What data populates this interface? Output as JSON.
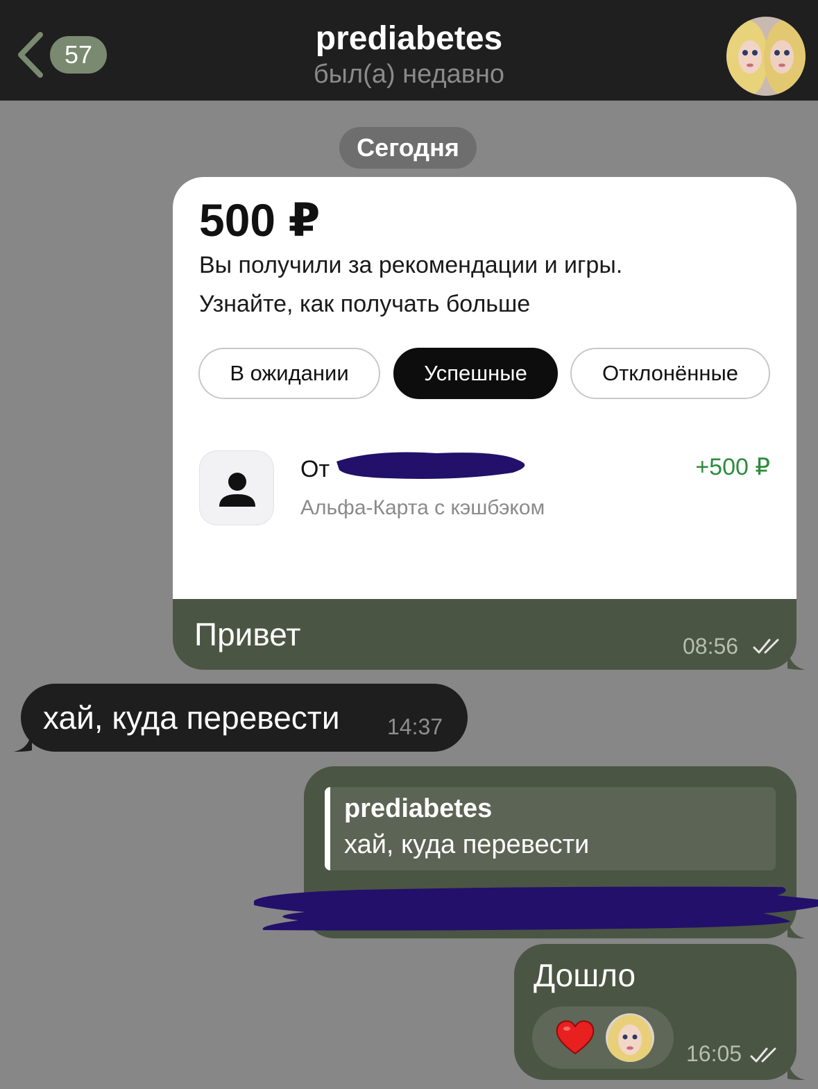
{
  "header": {
    "back_count": "57",
    "title": "prediabetes",
    "status": "был(а) недавно"
  },
  "date_separator": "Сегодня",
  "payment_card": {
    "amount": "500 ₽",
    "line1": "Вы получили за рекомендации и игры.",
    "line2": "Узнайте, как получать больше",
    "chips": [
      {
        "label": "В ожидании",
        "active": false
      },
      {
        "label": "Успешные",
        "active": true
      },
      {
        "label": "Отклонённые",
        "active": false
      }
    ],
    "transaction": {
      "from_prefix": "От",
      "subtitle": "Альфа-Карта с кэшбэком",
      "amount": "+500 ₽"
    }
  },
  "messages": [
    {
      "direction": "out",
      "text": "Привет",
      "time": "08:56"
    },
    {
      "direction": "in",
      "text": "хай, куда перевести",
      "time": "14:37"
    },
    {
      "direction": "out",
      "reply_to": {
        "name": "prediabetes",
        "text": "хай, куда перевести"
      }
    },
    {
      "direction": "out",
      "text": "Дошло",
      "time": "16:05",
      "reaction": "heart"
    }
  ],
  "colors": {
    "chat_bg": "#878787",
    "header_bg": "#1f1f1f",
    "outgoing_bubble": "#4b5543",
    "incoming_bubble": "#1e1e1e",
    "amount_green": "#2e8b3e",
    "redaction": "#23106a"
  }
}
